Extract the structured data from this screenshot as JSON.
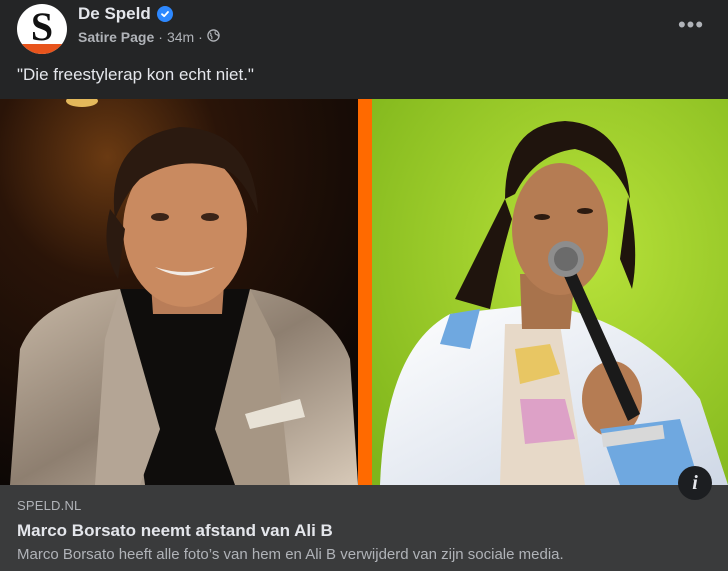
{
  "header": {
    "page_name": "De Speld",
    "avatar_letter": "S",
    "subtitle": "Satire Page",
    "separator": "·",
    "time": "34m",
    "more_label": "•••"
  },
  "post": {
    "text": "\"Die freestylerap kon echt niet.\""
  },
  "image": {
    "left_description": "Man in satin suit, dark shirt, smiling",
    "right_description": "Man with microphone, white track jacket, green background"
  },
  "link": {
    "domain": "SPELD.NL",
    "title": "Marco Borsato neemt afstand van Ali B",
    "description": "Marco Borsato heeft alle foto’s van hem en Ali B verwijderd van zijn sociale media.",
    "info_label": "i"
  },
  "colors": {
    "background": "#242526",
    "card": "#3a3b3c",
    "verified": "#2d88ff",
    "divider": "#ff6a00",
    "right_bg": "#9acd23"
  },
  "icons": [
    "verified-badge-icon",
    "globe-icon",
    "more-options-icon",
    "info-icon"
  ]
}
